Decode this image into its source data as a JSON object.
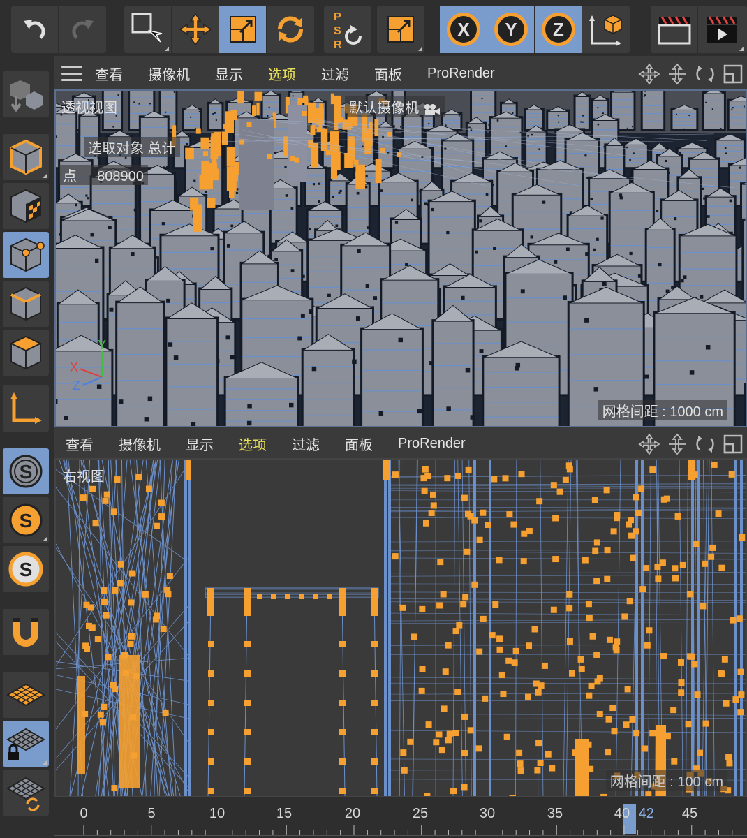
{
  "top_toolbar": {
    "groups": [
      {
        "name": "history",
        "buttons": [
          {
            "icon": "undo-icon",
            "active": false
          },
          {
            "icon": "redo-icon",
            "active": false
          }
        ]
      },
      {
        "name": "tools",
        "buttons": [
          {
            "icon": "select-rect-icon",
            "active": false
          },
          {
            "icon": "move-icon",
            "active": false
          },
          {
            "icon": "scale-icon",
            "active": true
          },
          {
            "icon": "rotate-icon",
            "active": false
          }
        ]
      },
      {
        "name": "psr",
        "buttons": [
          {
            "icon": "psr-reset-icon",
            "label": "PSR",
            "active": false
          }
        ]
      },
      {
        "name": "snap",
        "buttons": [
          {
            "icon": "scale-tool-icon",
            "active": false
          }
        ]
      },
      {
        "name": "axes",
        "buttons": [
          {
            "icon": "axis-x-icon",
            "label": "X",
            "active": true
          },
          {
            "icon": "axis-y-icon",
            "label": "Y",
            "active": true
          },
          {
            "icon": "axis-z-icon",
            "label": "Z",
            "active": true
          },
          {
            "icon": "coordinate-system-icon",
            "active": false
          }
        ]
      },
      {
        "name": "render",
        "buttons": [
          {
            "icon": "render-view-icon",
            "active": false
          },
          {
            "icon": "render-to-picture-viewer-icon",
            "active": false
          }
        ]
      }
    ]
  },
  "left_toolbar": {
    "buttons": [
      {
        "icon": "make-editable-icon",
        "active": false
      },
      {
        "icon": "model-mode-icon",
        "active": false
      },
      {
        "icon": "texture-mode-icon",
        "active": false
      },
      {
        "icon": "points-mode-icon",
        "active": true
      },
      {
        "icon": "edges-mode-icon",
        "active": false
      },
      {
        "icon": "polygons-mode-icon",
        "active": false
      },
      {
        "icon": "axis-mode-icon",
        "active": false
      },
      {
        "icon": "snap-icon",
        "active": true
      },
      {
        "icon": "snap-settings-icon",
        "active": false
      },
      {
        "icon": "snap-enable-icon",
        "active": false
      },
      {
        "icon": "magnet-icon",
        "active": false
      },
      {
        "icon": "workplane-icon",
        "active": false
      },
      {
        "icon": "locked-workplane-icon",
        "active": true
      },
      {
        "icon": "workplane-sync-icon",
        "active": false
      }
    ]
  },
  "viewport_top": {
    "menu": [
      "查看",
      "摄像机",
      "显示",
      "选项",
      "过滤",
      "面板",
      "ProRender"
    ],
    "highlighted_menu": "选项",
    "view_name": "透视视图",
    "camera_label": "默认摄像机",
    "stats_title": "选取对象 总计",
    "stats_row_label": "点",
    "stats_row_value": "808900",
    "grid_spacing": "网格间距 : 1000 cm",
    "axis_labels": {
      "x": "X",
      "y": "Y",
      "z": "Z"
    }
  },
  "viewport_bottom": {
    "menu": [
      "查看",
      "摄像机",
      "显示",
      "选项",
      "过滤",
      "面板",
      "ProRender"
    ],
    "highlighted_menu": "选项",
    "view_name": "右视图",
    "grid_spacing": "网格间距 : 100 cm"
  },
  "timeline": {
    "ticks": [
      "0",
      "5",
      "10",
      "15",
      "20",
      "25",
      "30",
      "35",
      "40",
      "45"
    ],
    "current_frame": "42",
    "current_frame_value": 42
  },
  "colors": {
    "accent": "#7a9ccd",
    "selection_orange": "#f5a030",
    "menu_highlight": "#e8e05a",
    "building_gray": "#8a8f99",
    "wire_blue": "#6b8fc9"
  }
}
